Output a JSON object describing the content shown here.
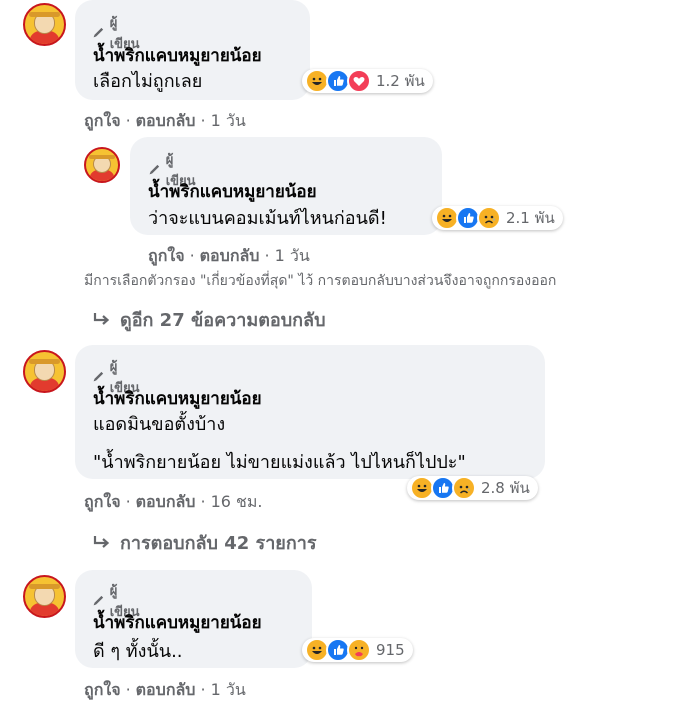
{
  "author_badge": "ผู้เขียน",
  "comments": [
    {
      "name": "น้ำพริกแคบหมูยายน้อย",
      "text": [
        "เลือกไม่ถูกเลย"
      ],
      "reactions": [
        "haha-icon",
        "like-icon",
        "love-icon"
      ],
      "reaction_count": "1.2 พัน",
      "like": "ถูกใจ",
      "reply": "ตอบกลับ",
      "time": "1 วัน"
    },
    {
      "name": "น้ำพริกแคบหมูยายน้อย",
      "text": [
        "ว่าจะแบนคอมเม้นท์ไหนก่อนดี!"
      ],
      "reactions": [
        "haha-icon",
        "like-icon",
        "sad-icon"
      ],
      "reaction_count": "2.1 พัน",
      "like": "ถูกใจ",
      "reply": "ตอบกลับ",
      "time": "1 วัน"
    },
    {
      "name": "น้ำพริกแคบหมูยายน้อย",
      "text": [
        "แอดมินขอตั้งบ้าง",
        "\"น้ำพริกยายน้อย ไม่ขายแม่งแล้ว ไปไหนก็ไปปะ\""
      ],
      "reactions": [
        "haha-icon",
        "like-icon",
        "sad-icon"
      ],
      "reaction_count": "2.8 พัน",
      "like": "ถูกใจ",
      "reply": "ตอบกลับ",
      "time": "16 ชม."
    },
    {
      "name": "น้ำพริกแคบหมูยายน้อย",
      "text": [
        "ดี ๆ ทั้งนั้น.."
      ],
      "reactions": [
        "haha-icon",
        "like-icon",
        "care-icon"
      ],
      "reaction_count": "915",
      "like": "ถูกใจ",
      "reply": "ตอบกลับ",
      "time": "1 วัน"
    }
  ],
  "filter_note": "มีการเลือกตัวกรอง \"เกี่ยวข้องที่สุด\" ไว้ การตอบกลับบางส่วนจึงอาจถูกกรองออก",
  "view_more_replies": "ดูอีก 27 ข้อความตอบกลับ",
  "replies_count": "การตอบกลับ 42 รายการ",
  "colors": {
    "bubble": "#f0f2f5",
    "secondary_text": "#65676b",
    "like_blue": "#1877f2"
  }
}
